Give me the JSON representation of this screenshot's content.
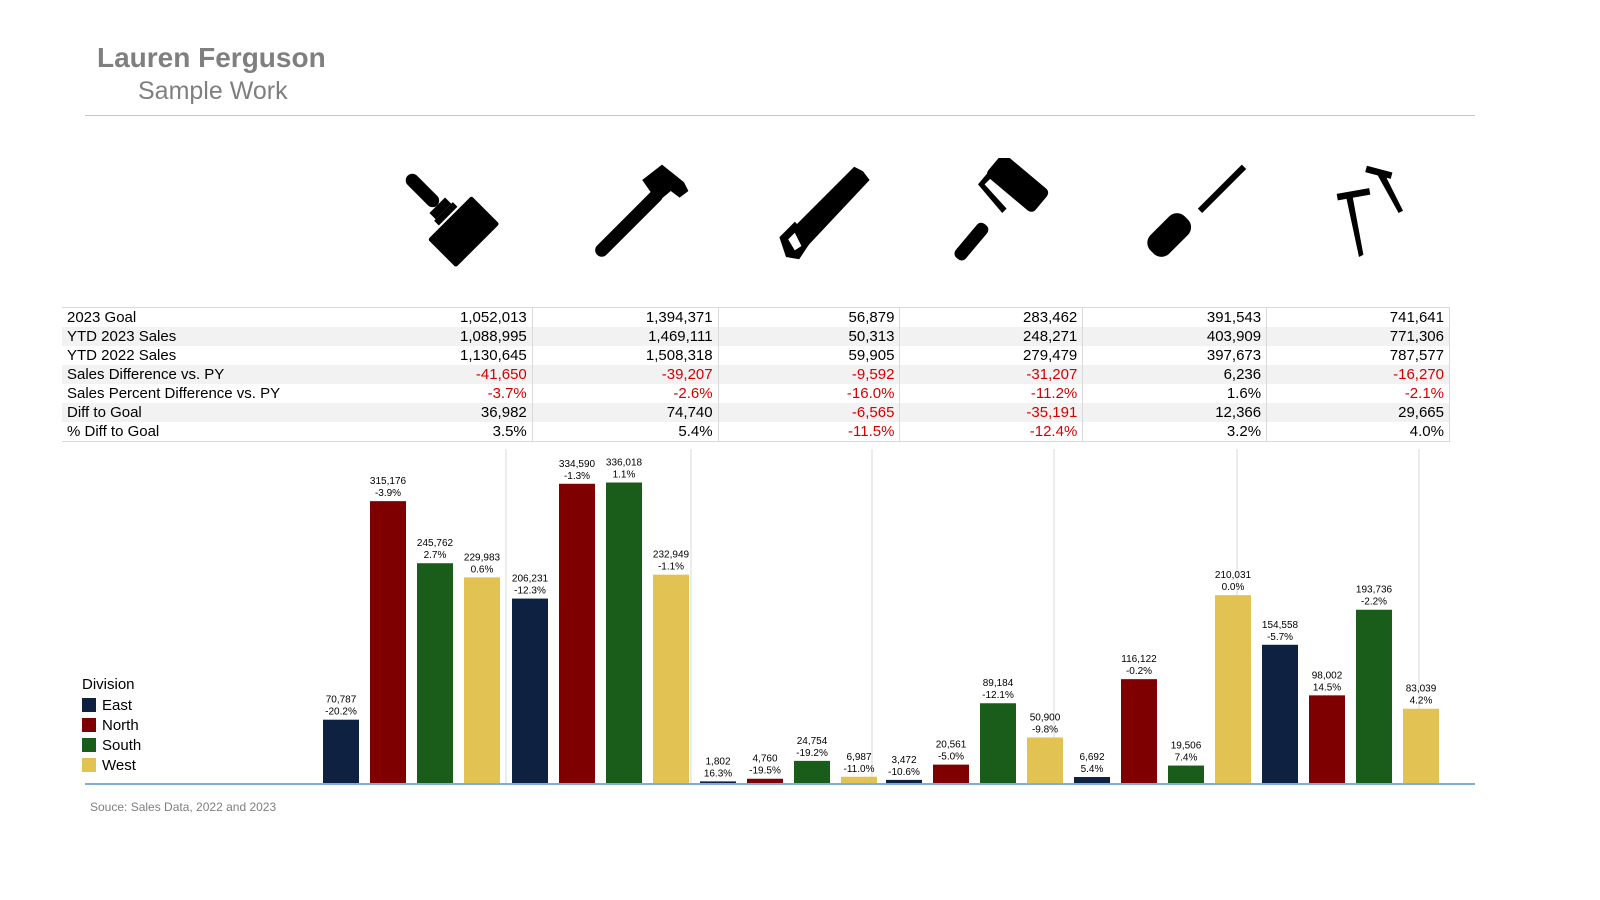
{
  "header": {
    "title": "Lauren Ferguson",
    "subtitle": "Sample Work"
  },
  "icons": [
    "paintbrush-icon",
    "hammer-icon",
    "saw-icon",
    "paint-roller-icon",
    "screwdriver-icon",
    "nails-icon"
  ],
  "metrics": {
    "rows": [
      {
        "label": "2023 Goal",
        "values": [
          "1,052,013",
          "1,394,371",
          "56,879",
          "283,462",
          "391,543",
          "741,641"
        ]
      },
      {
        "label": "YTD 2023 Sales",
        "values": [
          "1,088,995",
          "1,469,111",
          "50,313",
          "248,271",
          "403,909",
          "771,306"
        ]
      },
      {
        "label": "YTD 2022 Sales",
        "values": [
          "1,130,645",
          "1,508,318",
          "59,905",
          "279,479",
          "397,673",
          "787,577"
        ]
      },
      {
        "label": "Sales Difference vs. PY",
        "values": [
          "-41,650",
          "-39,207",
          "-9,592",
          "-31,207",
          "6,236",
          "-16,270"
        ]
      },
      {
        "label": "Sales Percent Difference vs. PY",
        "values": [
          "-3.7%",
          "-2.6%",
          "-16.0%",
          "-11.2%",
          "1.6%",
          "-2.1%"
        ]
      },
      {
        "label": "Diff to Goal",
        "values": [
          "36,982",
          "74,740",
          "-6,565",
          "-35,191",
          "12,366",
          "29,665"
        ]
      },
      {
        "label": "% Diff to Goal",
        "values": [
          "3.5%",
          "5.4%",
          "-11.5%",
          "-12.4%",
          "3.2%",
          "4.0%"
        ]
      }
    ],
    "negative_color": "#d40000"
  },
  "legend": {
    "title": "Division",
    "items": [
      {
        "label": "East",
        "color": "#0f2140"
      },
      {
        "label": "North",
        "color": "#7f0000"
      },
      {
        "label": "South",
        "color": "#1a5c1a"
      },
      {
        "label": "West",
        "color": "#e2c253"
      }
    ]
  },
  "chart_data": {
    "type": "bar",
    "series": [
      {
        "name": "East",
        "values": [
          70787,
          206231,
          1802,
          3472,
          6692,
          154558
        ],
        "labels": [
          "70,787",
          "206,231",
          "1,802",
          "3,472",
          "6,692",
          "154,558"
        ],
        "pct": [
          "-20.2%",
          "-12.3%",
          "16.3%",
          "-10.6%",
          "5.4%",
          "-5.7%"
        ]
      },
      {
        "name": "North",
        "values": [
          315176,
          334590,
          4760,
          20561,
          116122,
          98002
        ],
        "labels": [
          "315,176",
          "334,590",
          "4,760",
          "20,561",
          "116,122",
          "98,002"
        ],
        "pct": [
          "-3.9%",
          "-1.3%",
          "-19.5%",
          "-5.0%",
          "-0.2%",
          "14.5%"
        ]
      },
      {
        "name": "South",
        "values": [
          245762,
          336018,
          24754,
          89184,
          19506,
          193736
        ],
        "labels": [
          "245,762",
          "336,018",
          "24,754",
          "89,184",
          "19,506",
          "193,736"
        ],
        "pct": [
          "2.7%",
          "1.1%",
          "-19.2%",
          "-12.1%",
          "7.4%",
          "-2.2%"
        ]
      },
      {
        "name": "West",
        "values": [
          229983,
          232949,
          6987,
          50900,
          210031,
          83039
        ],
        "labels": [
          "229,983",
          "232,949",
          "6,987",
          "50,900",
          "210,031",
          "83,039"
        ],
        "pct": [
          "0.6%",
          "-1.1%",
          "-11.0%",
          "-9.8%",
          "0.0%",
          "4.2%"
        ]
      }
    ],
    "colors": [
      "#0f2140",
      "#7f0000",
      "#1a5c1a",
      "#e2c253"
    ],
    "ylim": [
      0,
      350000
    ],
    "grid": false,
    "legend": "left"
  },
  "footer": {
    "source": "Souce: Sales Data, 2022 and 2023"
  }
}
